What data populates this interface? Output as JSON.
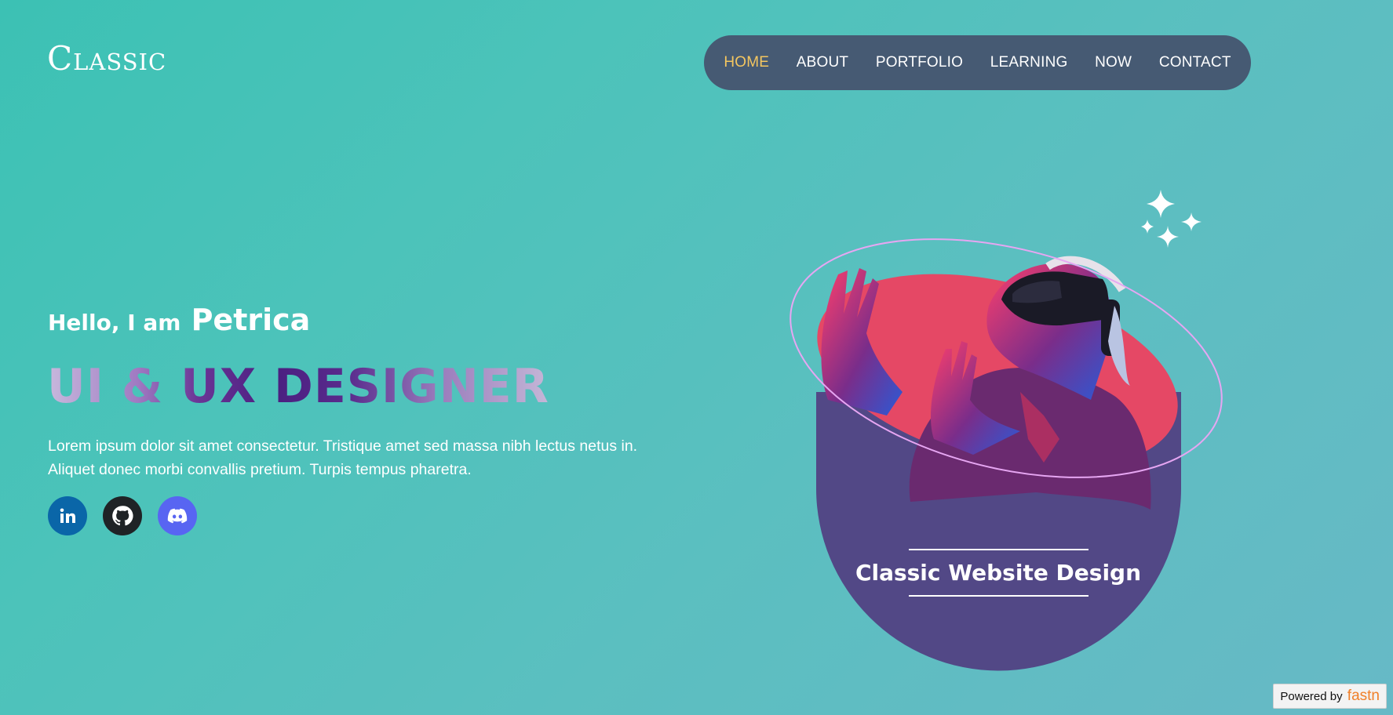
{
  "logo": {
    "text": "Classic"
  },
  "nav": {
    "items": [
      {
        "label": "HOME",
        "active": true
      },
      {
        "label": "ABOUT"
      },
      {
        "label": "PORTFOLIO"
      },
      {
        "label": "LEARNING"
      },
      {
        "label": "NOW"
      },
      {
        "label": "CONTACT"
      }
    ]
  },
  "intro": {
    "hello": "Hello, I am",
    "name": "Petrica",
    "role": "UI & UX DESIGNER",
    "bio_line1": "Lorem ipsum dolor sit amet consectetur. Tristique amet sed massa nibh lectus netus in.",
    "bio_line2": "Aliquet donec morbi convallis pretium. Turpis tempus pharetra."
  },
  "socials": [
    {
      "name": "linkedin",
      "icon": "linkedin-icon"
    },
    {
      "name": "github",
      "icon": "github-icon"
    },
    {
      "name": "discord",
      "icon": "discord-icon"
    }
  ],
  "hero": {
    "caption": "Classic Website Design"
  },
  "footer": {
    "powered_label": "Powered by",
    "brand": "fastn"
  },
  "colors": {
    "nav_bg": "#465a73",
    "nav_active": "#f3c660",
    "card_purple": "#524886",
    "card_pink": "#e54865",
    "linkedin": "#0a66a8",
    "github": "#1f2326",
    "discord": "#5865f2"
  }
}
